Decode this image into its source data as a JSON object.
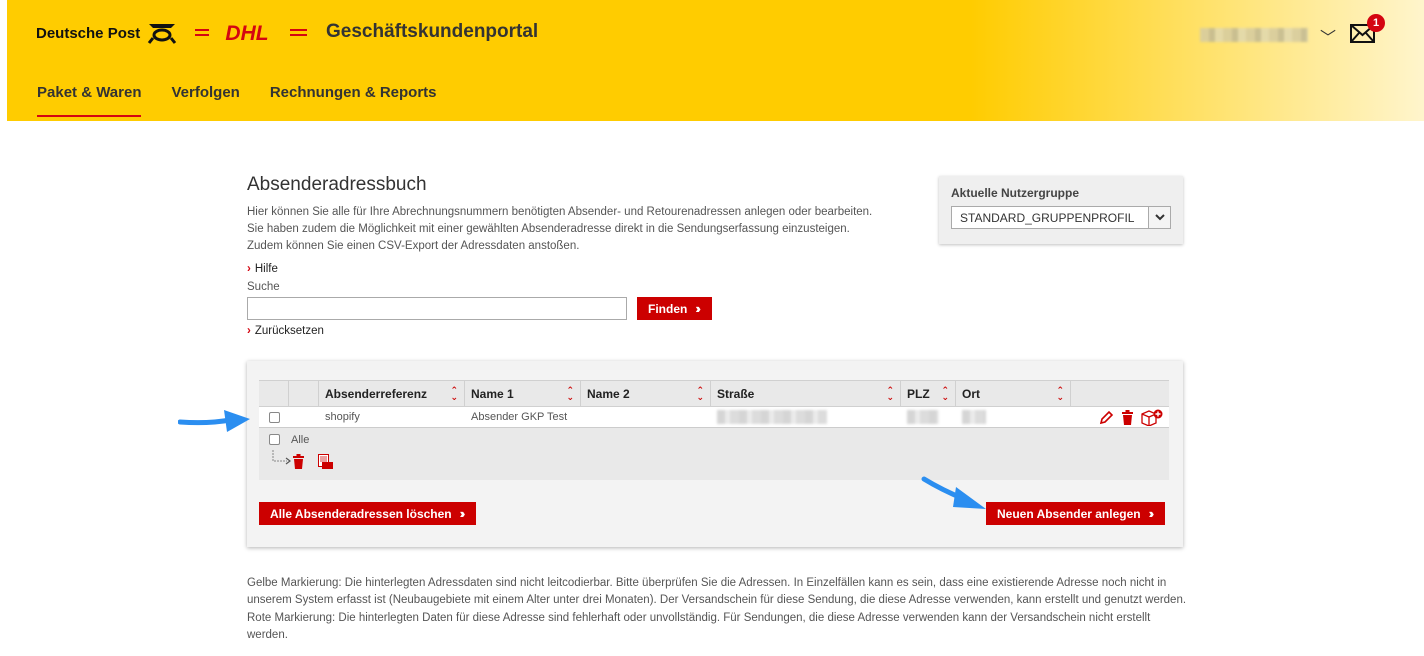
{
  "header": {
    "brand_dp": "Deutsche Post",
    "brand_dhl": "DHL",
    "portal_title": "Geschäftskundenportal",
    "mail_count": "1"
  },
  "nav": [
    {
      "label": "Paket & Waren",
      "active": true
    },
    {
      "label": "Verfolgen",
      "active": false
    },
    {
      "label": "Rechnungen & Reports",
      "active": false
    }
  ],
  "main": {
    "title": "Absenderadressbuch",
    "intro_lines": [
      "Hier können Sie alle für Ihre Abrechnungsnummern benötigten Absender- und Retourenadressen anlegen oder bearbeiten.",
      "Sie haben zudem die Möglichkeit mit einer gewählten Absenderadresse direkt in die Sendungserfassung einzusteigen.",
      "Zudem können Sie einen CSV-Export der Adressdaten anstoßen."
    ],
    "help_link": "Hilfe",
    "search_label": "Suche",
    "search_value": "",
    "find_button": "Finden",
    "reset_link": "Zurücksetzen"
  },
  "user_group": {
    "label": "Aktuelle Nutzergruppe",
    "selected": "STANDARD_GRUPPENPROFIL"
  },
  "table": {
    "columns": [
      "Absenderreferenz",
      "Name 1",
      "Name 2",
      "Straße",
      "PLZ",
      "Ort"
    ],
    "rows": [
      {
        "reference": "shopify",
        "name1": "Absender GKP Test",
        "name2": ""
      }
    ],
    "select_all_label": "Alle"
  },
  "buttons": {
    "delete_all": "Alle Absenderadressen löschen",
    "new_sender": "Neuen Absender anlegen"
  },
  "notes": {
    "yellow": "Gelbe Markierung: Die hinterlegten Adressdaten sind nicht leitcodierbar. Bitte überprüfen Sie die Adressen. In Einzelfällen kann es sein, dass eine existierende Adresse noch nicht in unserem System erfasst ist (Neubaugebiete mit einem Alter unter drei Monaten). Der Versandschein für diese Sendung, die diese Adresse verwenden, kann erstellt und genutzt werden.",
    "red": "Rote Markierung: Die hinterlegten Daten für diese Adresse sind fehlerhaft oder unvollständig. Für Sendungen, die diese Adresse verwenden kann der Versandschein nicht erstellt werden."
  },
  "colors": {
    "brand_yellow": "#ffcc00",
    "brand_red": "#d40511",
    "button_red": "#cc0000",
    "annotation_blue": "#2b8ef0"
  }
}
